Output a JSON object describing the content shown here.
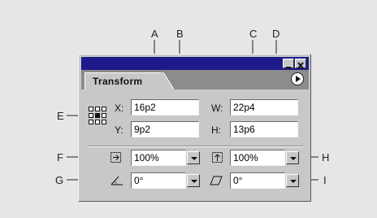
{
  "callouts": [
    "A",
    "B",
    "C",
    "D",
    "E",
    "F",
    "G",
    "H",
    "I"
  ],
  "panel": {
    "tab_label": "Transform",
    "x_label": "X:",
    "y_label": "Y:",
    "w_label": "W:",
    "h_label": "H:",
    "x_value": "16p2",
    "y_value": "9p2",
    "w_value": "22p4",
    "h_value": "13p6",
    "scale_x_value": "100%",
    "scale_y_value": "100%",
    "rotation_value": "0°",
    "shear_value": "0°"
  },
  "icons": [
    "reference-point-grid-icon",
    "scale-x-icon",
    "scale-y-icon",
    "rotate-icon",
    "shear-icon",
    "panel-menu-icon",
    "minimize-icon",
    "close-icon"
  ]
}
